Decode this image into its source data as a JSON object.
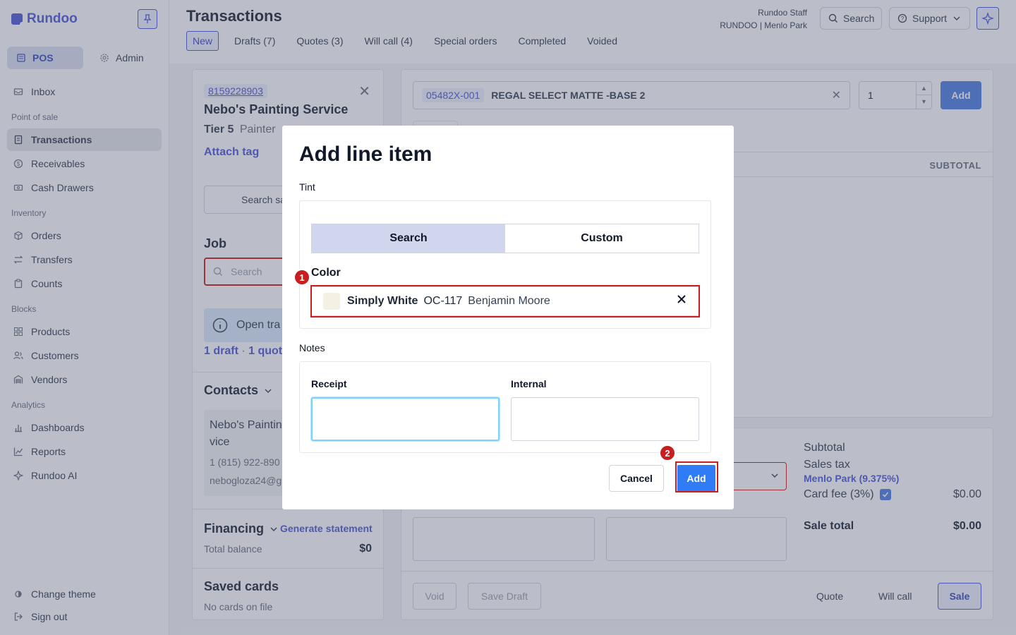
{
  "sidebar": {
    "brand": "Rundoo",
    "modes": {
      "pos": "POS",
      "admin": "Admin"
    },
    "inbox": "Inbox",
    "sections": {
      "pos": "Point of sale",
      "inventory": "Inventory",
      "blocks": "Blocks",
      "analytics": "Analytics"
    },
    "items": {
      "transactions": "Transactions",
      "receivables": "Receivables",
      "cash_drawers": "Cash Drawers",
      "orders": "Orders",
      "transfers": "Transfers",
      "counts": "Counts",
      "products": "Products",
      "customers": "Customers",
      "vendors": "Vendors",
      "dashboards": "Dashboards",
      "reports": "Reports",
      "rundoo_ai": "Rundoo AI"
    },
    "change_theme": "Change theme",
    "sign_out": "Sign out"
  },
  "header": {
    "title": "Transactions",
    "tabs": [
      "New",
      "Drafts (7)",
      "Quotes (3)",
      "Will call (4)",
      "Special orders",
      "Completed",
      "Voided"
    ],
    "user_name": "Rundoo Staff",
    "user_location": "RUNDOO | Menlo Park",
    "search": "Search",
    "support": "Support"
  },
  "customer": {
    "phone": "8159228903",
    "name": "Nebo's Painting Service",
    "tier": "Tier 5",
    "type": "Painter",
    "attach_tag": "Attach tag",
    "search_sales": "Search sa",
    "job_label": "Job",
    "job_search": "Search",
    "open_transactions": "Open tra",
    "drafts_link": "1 draft",
    "quotes_link": "1 quot",
    "contacts_label": "Contacts",
    "contact_name_1": "Nebo's Paintin",
    "contact_name_2": "vice",
    "contact_phone": "1 (815) 922-890",
    "contact_email": "nebogloza24@g",
    "financing_label": "Financing",
    "generate_statement": "Generate statement",
    "total_balance_label": "Total balance",
    "total_balance": "$0",
    "saved_cards_label": "Saved cards",
    "no_cards": "No cards on file"
  },
  "cart": {
    "sku": "05482X-001",
    "product": "REGAL SELECT MATTE -BASE 2",
    "qty": "1",
    "add": "Add",
    "subtotal_col": "SUBTOTAL",
    "subtotal_label": "Subtotal",
    "sales_tax_label": "Sales tax",
    "tax_location": "Menlo Park (9.375%)",
    "card_fee_label": "Card fee (3%)",
    "card_fee_value": "$0.00",
    "sale_total_label": "Sale total",
    "sale_total_value": "$0.00",
    "void": "Void",
    "save_draft": "Save Draft",
    "quote": "Quote",
    "will_call": "Will call",
    "sale": "Sale"
  },
  "modal": {
    "title": "Add line item",
    "tint_label": "Tint",
    "segment_search": "Search",
    "segment_custom": "Custom",
    "color_label": "Color",
    "color_name": "Simply White",
    "color_code": "OC-117",
    "color_brand": "Benjamin Moore",
    "notes_label": "Notes",
    "receipt_label": "Receipt",
    "internal_label": "Internal",
    "receipt_value": "",
    "internal_value": "",
    "cancel": "Cancel",
    "add": "Add",
    "annotation_1": "1",
    "annotation_2": "2"
  }
}
